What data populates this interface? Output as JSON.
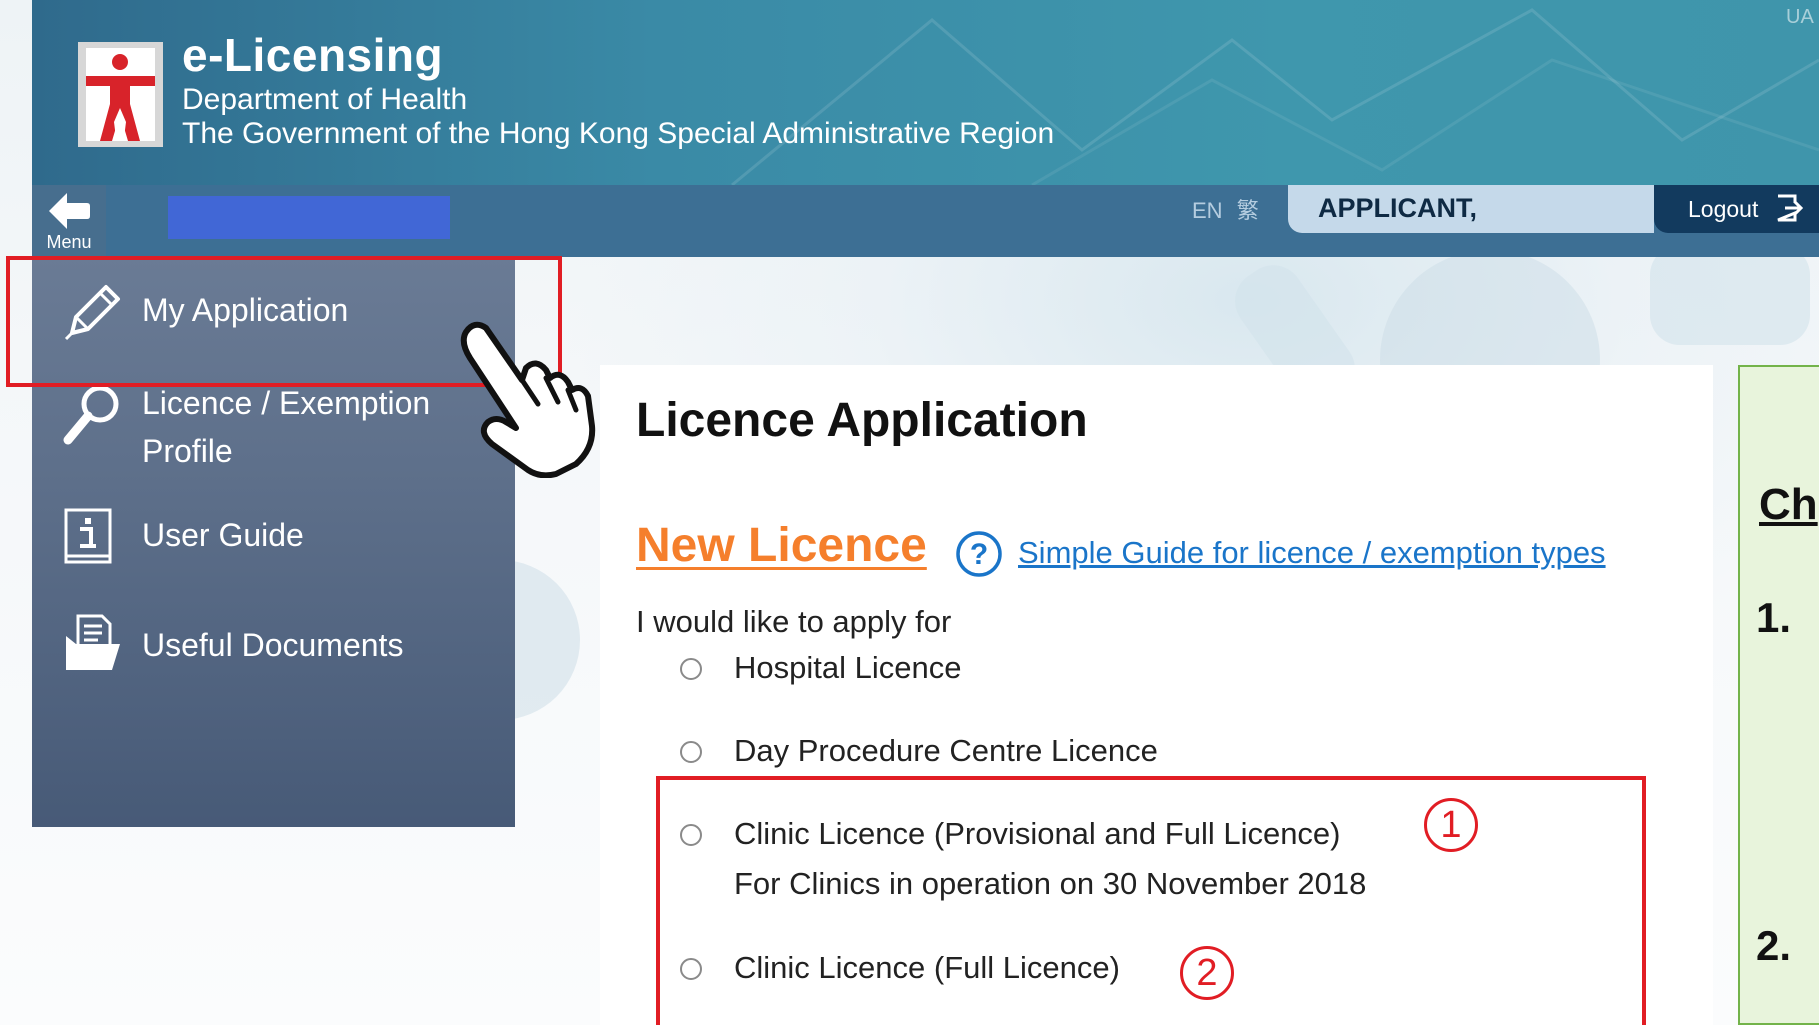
{
  "header": {
    "app_title": "e-Licensing",
    "department": "Department of Health",
    "government": "The Government of the Hong Kong Special Administrative Region",
    "corner_code": "UA"
  },
  "nav": {
    "menu_label": "Menu",
    "lang_en": "EN",
    "lang_tc": "繁",
    "user_name": "APPLICANT,",
    "logout_label": "Logout"
  },
  "sidebar": {
    "items": [
      {
        "label": "My Application",
        "icon": "pencil-icon"
      },
      {
        "label_line1": "Licence / Exemption",
        "label_line2": "Profile",
        "icon": "magnifier-icon"
      },
      {
        "label": "User Guide",
        "icon": "info-book-icon"
      },
      {
        "label": "Useful Documents",
        "icon": "documents-folder-icon"
      }
    ]
  },
  "main": {
    "page_title": "Licence Application",
    "section_title": "New Licence",
    "guide_link": "Simple Guide for licence / exemption types",
    "apply_prompt": "I would like to apply for",
    "options": [
      {
        "label": "Hospital Licence"
      },
      {
        "label": "Day Procedure Centre Licence"
      },
      {
        "label": "Clinic Licence (Provisional and Full Licence)",
        "sub": "For Clinics in operation on 30 November 2018",
        "marker": "1"
      },
      {
        "label": "Clinic Licence (Full Licence)",
        "marker": "2"
      }
    ]
  },
  "panel": {
    "heading": "Ch",
    "items": [
      "1.",
      "2."
    ]
  },
  "colors": {
    "banner": "#3a8aa6",
    "nav_bar": "#3d6f94",
    "sidebar": "#5d6f8a",
    "section_title": "#f57f2c",
    "link": "#1a75c9",
    "highlight": "#e11d24",
    "panel_bg": "#e8f4dc",
    "panel_border": "#73b34a"
  }
}
